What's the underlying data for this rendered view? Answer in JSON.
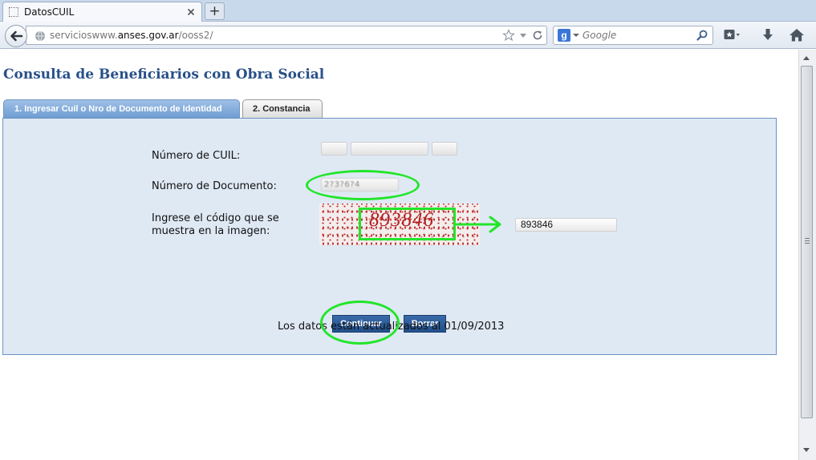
{
  "browser": {
    "tab_title": "DatosCUIL",
    "new_tab": "+",
    "url_prefix": "servicioswww.",
    "url_domain": "anses.gov.ar",
    "url_path": "/ooss2/",
    "search_engine_letter": "g",
    "search_placeholder": "Google"
  },
  "page": {
    "title": "Consulta de Beneficiarios con Obra Social",
    "tabs": [
      {
        "label": "1. Ingresar Cuil o Nro de Documento de Identidad"
      },
      {
        "label": "2. Constancia"
      }
    ],
    "form": {
      "cuil_label": "Número de CUIL:",
      "cuil_prefix": "",
      "cuil_number": "",
      "cuil_check": "",
      "documento_label": "Número de Documento:",
      "documento_value": "2?3?6?4",
      "captcha_label_line1": "Ingrese el código que se",
      "captcha_label_line2": "muestra en la imagen:",
      "captcha_image_text": "893846",
      "captcha_input_value": "893846"
    },
    "buttons": {
      "continuar": "Continuar",
      "borrar": "Borrar"
    },
    "status": "Los datos están actualizados al 01/09/2013"
  },
  "annotation": {
    "color": "#22e52a"
  }
}
